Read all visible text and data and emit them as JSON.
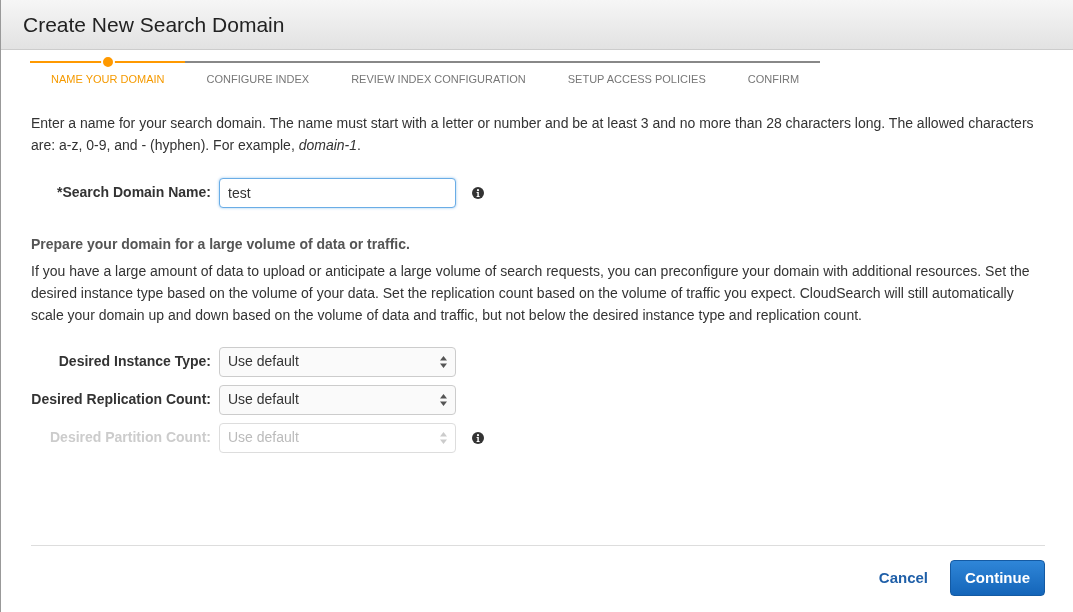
{
  "dialog": {
    "title": "Create New Search Domain"
  },
  "steps": [
    {
      "label": "NAME YOUR DOMAIN",
      "selected": true
    },
    {
      "label": "CONFIGURE INDEX",
      "selected": false
    },
    {
      "label": "REVIEW INDEX CONFIGURATION",
      "selected": false
    },
    {
      "label": "SETUP ACCESS POLICIES",
      "selected": false
    },
    {
      "label": "CONFIRM",
      "selected": false
    }
  ],
  "intro": "Enter a name for your search domain. The name must start with a letter or number and be at least 3 and no more than 28 characters long. The allowed characters are: a-z, 0-9, and - (hyphen). For example, *domain-1*.",
  "name_field": {
    "label": "*Search Domain Name:",
    "value": "test",
    "info": true
  },
  "section": {
    "heading": "Prepare your domain for a large volume of data or traffic.",
    "text": "If you have a large amount of data to upload or anticipate a large volume of search requests, you can preconfigure your domain with additional resources. Set the desired instance type based on the volume of your data. Set the replication count based on the volume of traffic you expect. CloudSearch will still automatically scale your domain up and down based on the volume of data and traffic, but not below the desired instance type and replication count."
  },
  "selects": [
    {
      "label": "Desired Instance Type:",
      "value": "Use default",
      "disabled": false,
      "info": false
    },
    {
      "label": "Desired Replication Count:",
      "value": "Use default",
      "disabled": false,
      "info": false
    },
    {
      "label": "Desired Partition Count:",
      "value": "Use default",
      "disabled": true,
      "info": true
    }
  ],
  "buttons": {
    "cancel": "Cancel",
    "continue": "Continue"
  }
}
